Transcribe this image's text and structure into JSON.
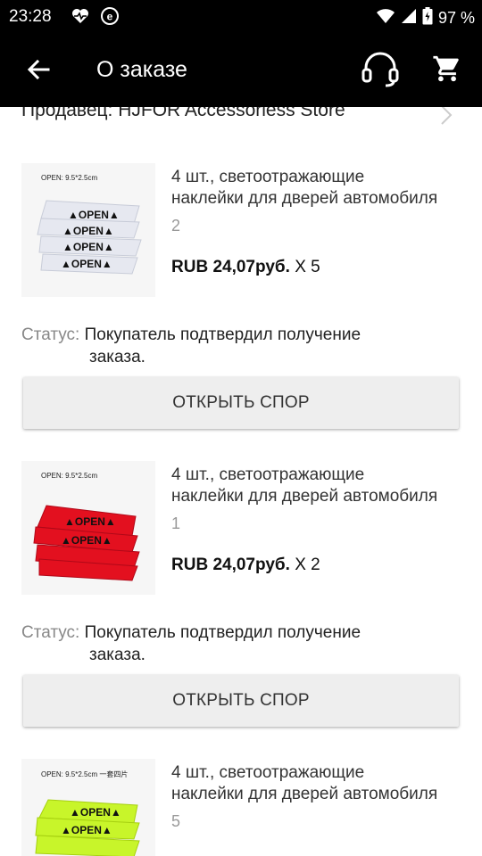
{
  "status_bar": {
    "time": "23:28",
    "battery": "97 %",
    "icons": [
      "heart-pulse-icon",
      "e-circle-icon",
      "wifi-icon",
      "signal-icon",
      "battery-icon"
    ]
  },
  "app_bar": {
    "title": "О заказе",
    "icons": [
      "back-arrow-icon",
      "support-headset-icon",
      "cart-icon"
    ]
  },
  "seller": {
    "label": "Продавец: HJFOR Accessoriess Store"
  },
  "items": [
    {
      "name_line1": "4 шт., светоотражающие",
      "name_line2": "наклейки для дверей автомобиля",
      "variant": "2",
      "price": "RUB 24,07руб.",
      "qty": "X 5",
      "status_label": "Статус:",
      "status_value_line1": "Покупатель подтвердил получение",
      "status_value_line2": "заказа.",
      "button": "ОТКРЫТЬ СПОР",
      "image_text": "OPEN:  9.5*2.5cm",
      "sticker_color": "#e8e8ee"
    },
    {
      "name_line1": "4 шт., светоотражающие",
      "name_line2": "наклейки для дверей автомобиля",
      "variant": "1",
      "price": "RUB 24,07руб.",
      "qty": "X 2",
      "status_label": "Статус:",
      "status_value_line1": "Покупатель подтвердил получение",
      "status_value_line2": "заказа.",
      "button": "ОТКРЫТЬ СПОР",
      "image_text": "OPEN:  9.5*2.5cm",
      "sticker_color": "#e3101f"
    },
    {
      "name_line1": "4 шт., светоотражающие",
      "name_line2": "наклейки для дверей автомобиля",
      "variant": "5",
      "image_text": "OPEN:  9.5*2.5cm  一套四片",
      "sticker_color": "#c8f52a"
    }
  ],
  "colors": {
    "bar_background": "#000000",
    "button_background": "#eeeeee",
    "muted_text": "#888888"
  }
}
